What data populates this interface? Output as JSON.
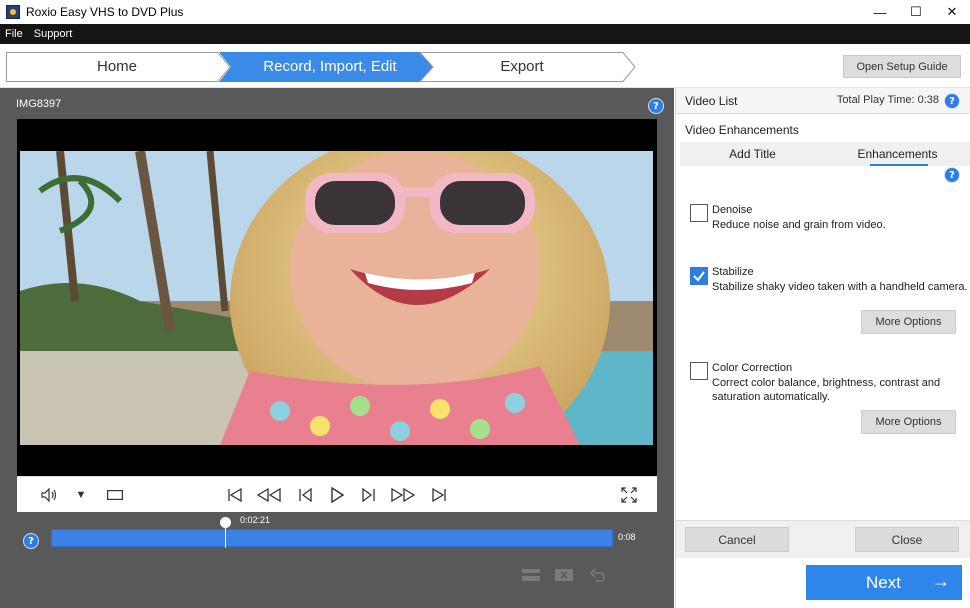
{
  "window": {
    "title": "Roxio Easy VHS to DVD Plus",
    "minimize_glyph": "—",
    "maximize_glyph": "☐",
    "close_glyph": "✕"
  },
  "menu": {
    "items": [
      {
        "label": "File"
      },
      {
        "label": "Support"
      }
    ]
  },
  "steps": {
    "items": [
      {
        "label": "Home",
        "active": false
      },
      {
        "label": "Record, Import, Edit",
        "active": true
      },
      {
        "label": "Export",
        "active": false
      }
    ],
    "active_color": "#3a8ae8"
  },
  "setup_guide_label": "Open Setup Guide",
  "player": {
    "clip_name": "IMG8397",
    "current_time": "0:02:21",
    "end_time": "0:08",
    "playhead_fraction": 0.31,
    "help_glyph": "?",
    "volume_dropdown_glyph": "▼"
  },
  "right_panel": {
    "video_list_label": "Video List",
    "total_play_time": "Total Play Time: 0:38",
    "section_title": "Video Enhancements",
    "tabs": [
      {
        "label": "Add Title",
        "active": false
      },
      {
        "label": "Enhancements",
        "active": true
      }
    ],
    "options": [
      {
        "title": "Denoise",
        "desc": "Reduce noise and grain from video.",
        "checked": false
      },
      {
        "title": "Stabilize",
        "desc": "Stabilize shaky video taken with a handheld camera.",
        "checked": true,
        "more_options_label": "More Options"
      },
      {
        "title": "Color Correction",
        "desc_line1": "Correct color balance, brightness, contrast and",
        "desc_line2": "saturation automatically.",
        "checked": false,
        "more_options_label": "More Options"
      }
    ],
    "cancel_label": "Cancel",
    "close_label": "Close",
    "next_label": "Next",
    "next_arrow": "→",
    "accent_color": "#2f7de0"
  }
}
